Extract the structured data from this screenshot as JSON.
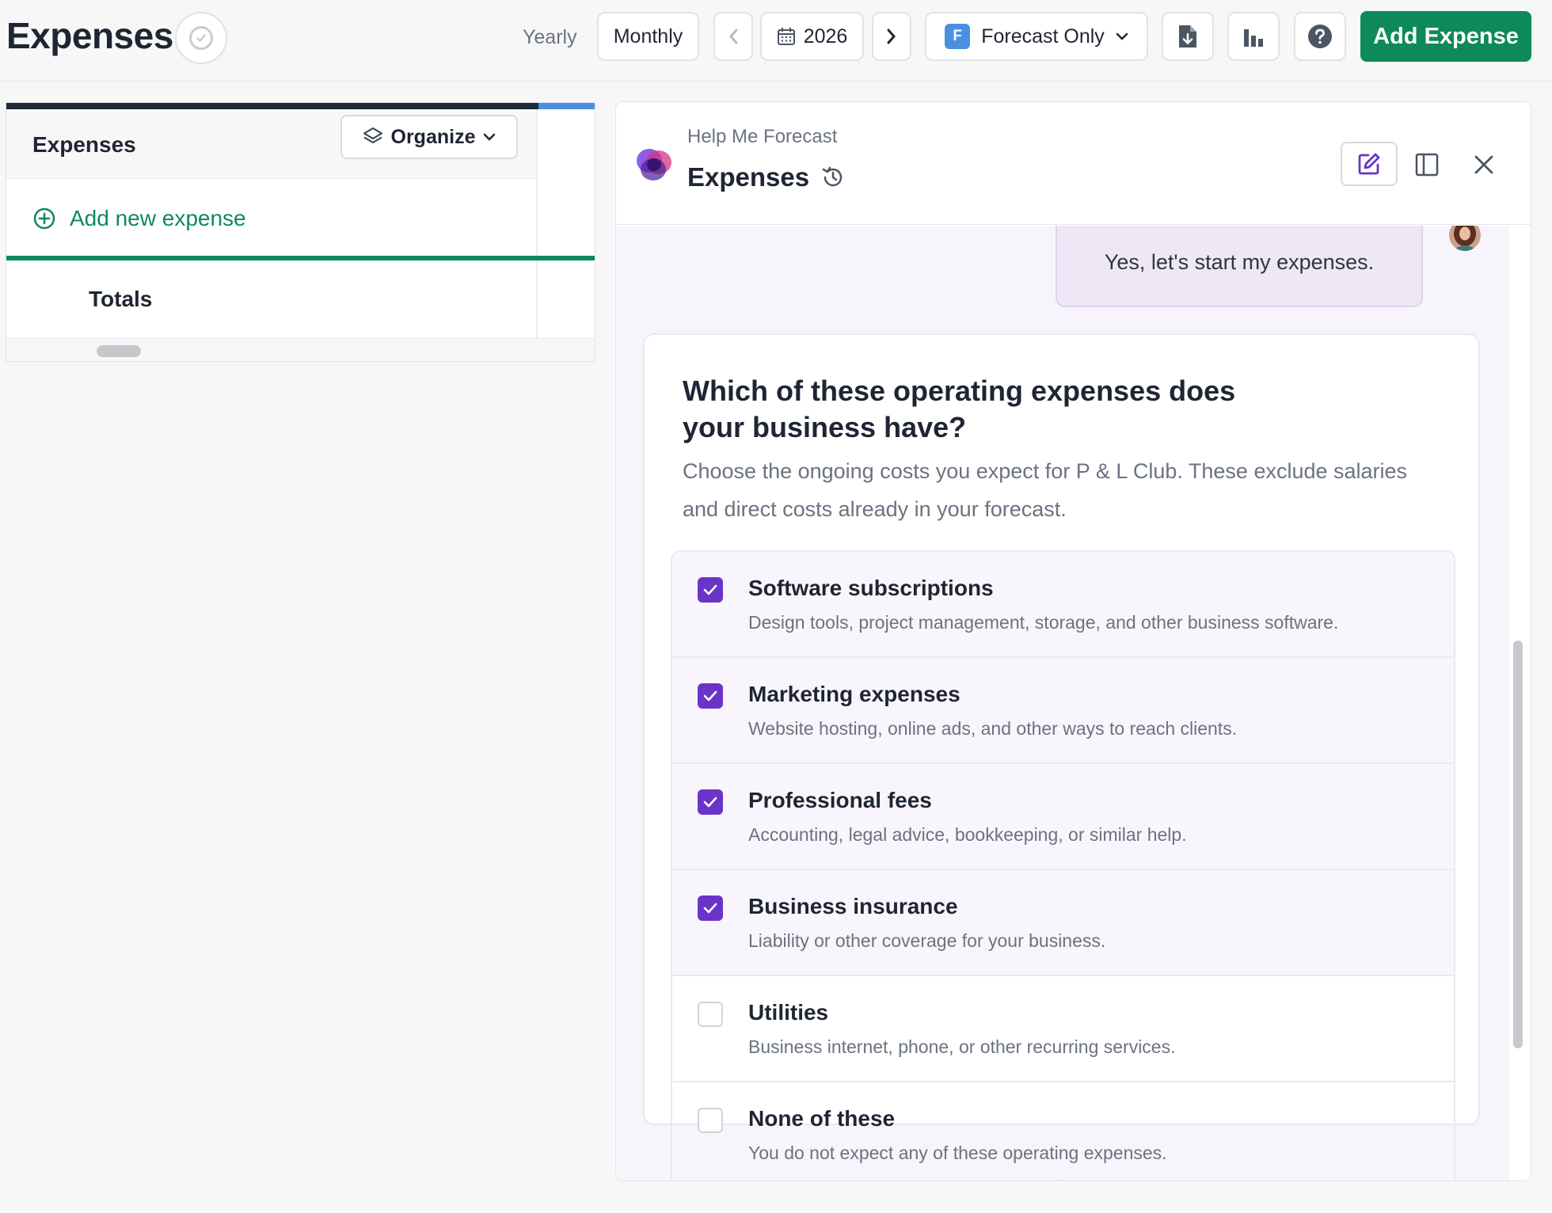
{
  "header": {
    "title": "Expenses",
    "yearly_label": "Yearly",
    "monthly_label": "Monthly",
    "year": "2026",
    "forecast_badge": "F",
    "forecast_label": "Forecast Only",
    "add_expense_label": "Add Expense"
  },
  "left_panel": {
    "title": "Expenses",
    "organize_label": "Organize",
    "add_new_label": "Add new expense",
    "totals_label": "Totals"
  },
  "assistant": {
    "subtitle": "Help Me Forecast",
    "title": "Expenses"
  },
  "chat": {
    "user_message": "Yes, let's start my expenses.",
    "question_title": "Which of these operating expenses does your business have?",
    "question_desc": "Choose the ongoing costs you expect for P & L Club. These exclude salaries and direct costs already in your forecast.",
    "options": [
      {
        "title": "Software subscriptions",
        "desc": "Design tools, project management, storage, and other business software.",
        "checked": true
      },
      {
        "title": "Marketing expenses",
        "desc": "Website hosting, online ads, and other ways to reach clients.",
        "checked": true
      },
      {
        "title": "Professional fees",
        "desc": "Accounting, legal advice, bookkeeping, or similar help.",
        "checked": true
      },
      {
        "title": "Business insurance",
        "desc": "Liability or other coverage for your business.",
        "checked": true
      },
      {
        "title": "Utilities",
        "desc": "Business internet, phone, or other recurring services.",
        "checked": false
      },
      {
        "title": "None of these",
        "desc": "You do not expect any of these operating expenses.",
        "checked": false
      }
    ]
  },
  "colors": {
    "brand_green": "#0e8a5a",
    "check_purple": "#6a34c9",
    "forecast_blue": "#4a90e2"
  }
}
